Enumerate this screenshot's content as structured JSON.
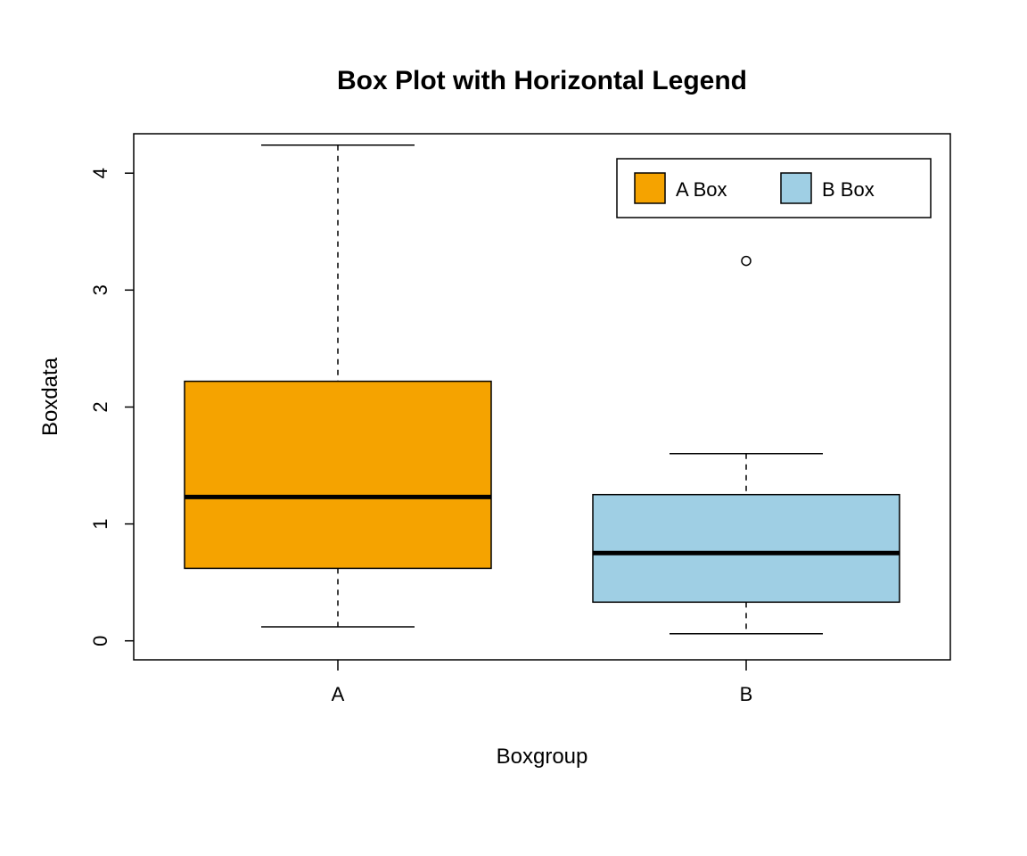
{
  "chart_data": {
    "type": "box",
    "title": "Box Plot with Horizontal Legend",
    "xlabel": "Boxgroup",
    "ylabel": "Boxdata",
    "categories": [
      "A",
      "B"
    ],
    "y_ticks": [
      0,
      1,
      2,
      3,
      4
    ],
    "ylim": [
      -0.15,
      4.35
    ],
    "series": [
      {
        "name": "A Box",
        "category": "A",
        "color": "#F5A300",
        "q1": 0.62,
        "median": 1.23,
        "q3": 2.22,
        "whisker_low": 0.12,
        "whisker_high": 4.24,
        "outliers": []
      },
      {
        "name": "B Box",
        "category": "B",
        "color": "#9FCFE4",
        "q1": 0.33,
        "median": 0.75,
        "q3": 1.25,
        "whisker_low": 0.06,
        "whisker_high": 1.6,
        "outliers": [
          3.25
        ]
      }
    ],
    "legend": {
      "items": [
        {
          "label": "A Box",
          "color": "#F5A300"
        },
        {
          "label": "B Box",
          "color": "#9FCFE4"
        }
      ]
    }
  }
}
